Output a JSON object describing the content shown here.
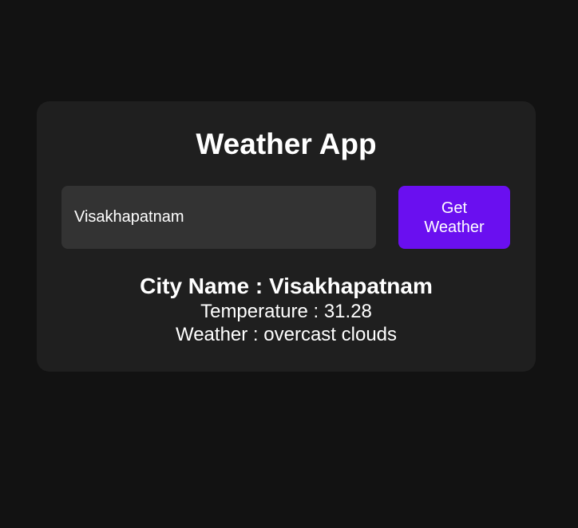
{
  "app": {
    "title": "Weather App"
  },
  "search": {
    "value": "Visakhapatnam",
    "button_label": "Get Weather"
  },
  "result": {
    "city_label": "City Name : ",
    "city_value": "Visakhapatnam",
    "temperature_label": "Temperature : ",
    "temperature_value": "31.28",
    "weather_label": "Weather : ",
    "weather_value": "overcast clouds"
  },
  "colors": {
    "page_background": "#121212",
    "card_background": "#1f1f1f",
    "input_background": "#333333",
    "button_accent": "#6a0ff0",
    "text": "#ffffff"
  }
}
